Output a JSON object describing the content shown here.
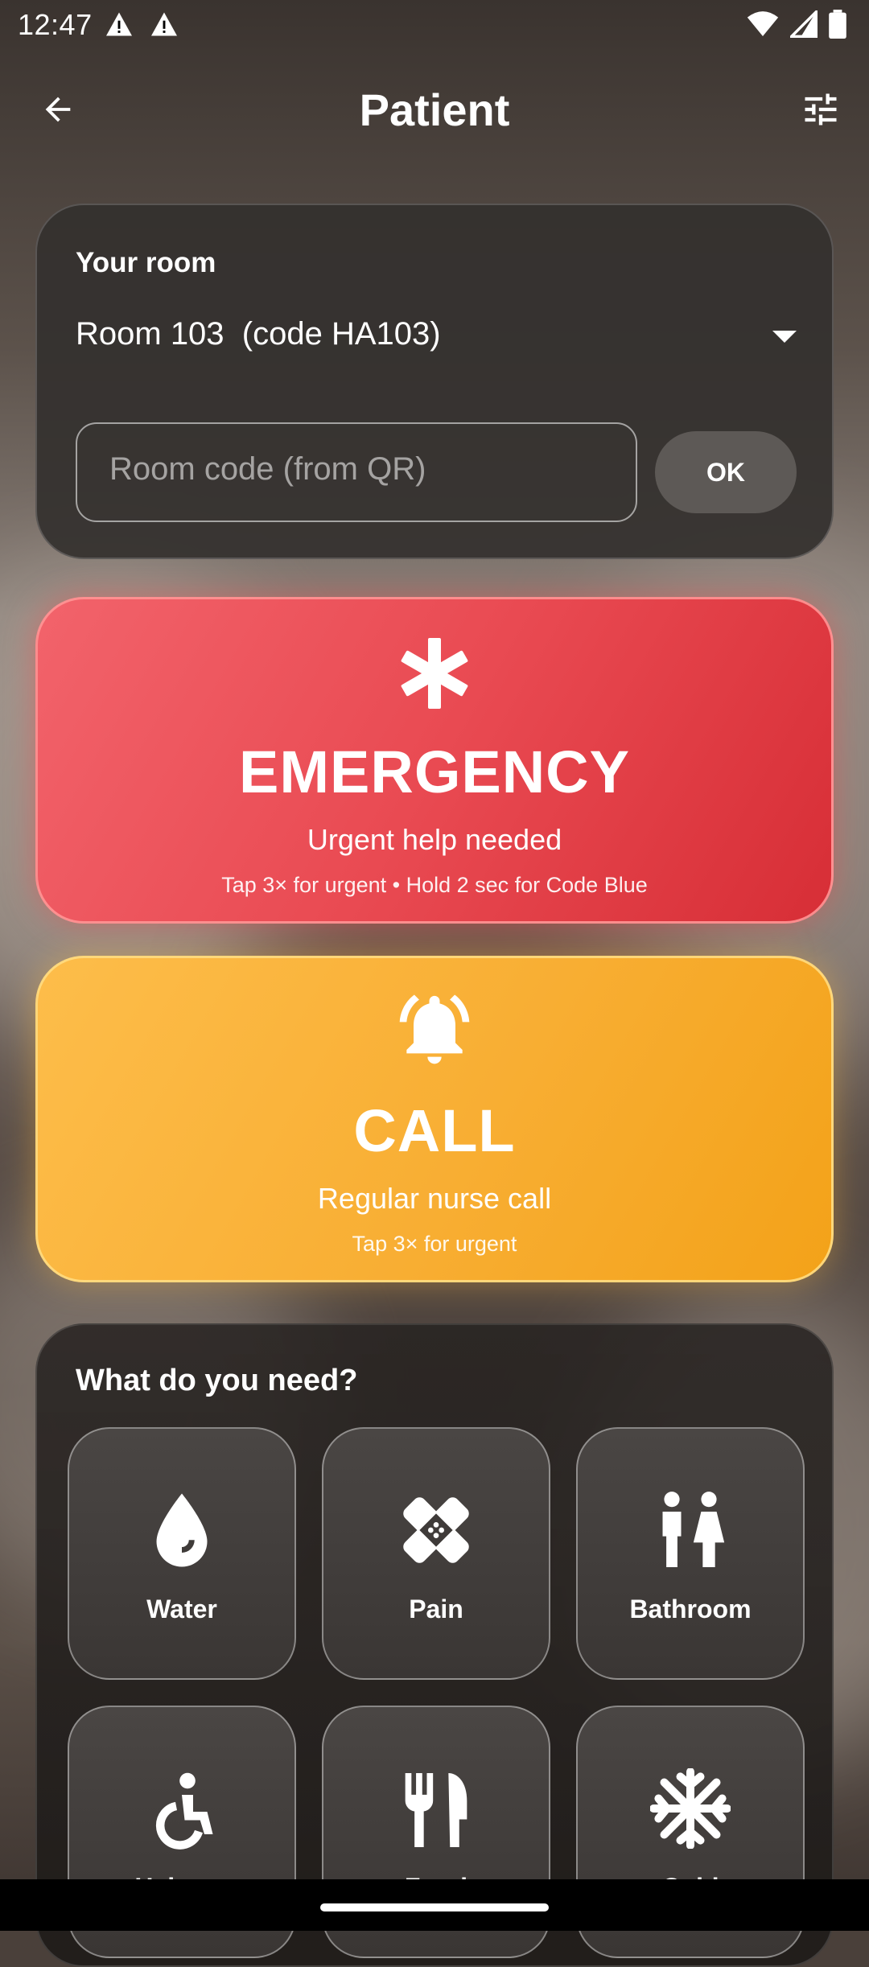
{
  "status": {
    "time": "12:47"
  },
  "appbar": {
    "title": "Patient"
  },
  "room": {
    "label": "Your room",
    "selected": "Room 103  (code HA103)",
    "code_placeholder": "Room code (from QR)",
    "ok_label": "OK"
  },
  "emergency": {
    "title": "EMERGENCY",
    "subtitle": "Urgent help needed",
    "hint": "Tap 3× for urgent • Hold 2 sec for Code Blue",
    "icon": "asterisk-icon",
    "color": "#e94a52"
  },
  "call": {
    "title": "CALL",
    "subtitle": "Regular nurse call",
    "hint": "Tap 3× for urgent",
    "icon": "bell-ring-icon",
    "color": "#f8ae33"
  },
  "needs": {
    "label": "What do you need?",
    "items": [
      {
        "label": "Water",
        "icon": "water-drop-icon"
      },
      {
        "label": "Pain",
        "icon": "bandage-icon"
      },
      {
        "label": "Bathroom",
        "icon": "restroom-icon"
      },
      {
        "label": "Help up",
        "icon": "wheelchair-icon"
      },
      {
        "label": "Food",
        "icon": "fork-knife-icon"
      },
      {
        "label": "Cold",
        "icon": "snowflake-icon"
      }
    ]
  }
}
